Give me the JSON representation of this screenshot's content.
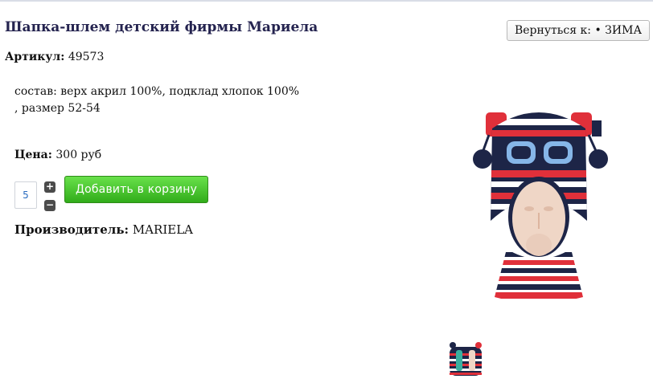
{
  "product": {
    "title": "Шапка-шлем детский фирмы Мариела",
    "sku_label": "Артикул:",
    "sku_value": "49573",
    "description_line1": "состав: верх акрил 100%, подклад хлопок 100%",
    "description_line2": ", размер 52-54",
    "price_label": "Цена:",
    "price_value": "300 руб",
    "manufacturer_label": "Производитель:",
    "manufacturer_value": "MARIELA"
  },
  "back_button": {
    "label": "Вернуться к: • ЗИМА"
  },
  "cart": {
    "quantity": "5",
    "plus": "+",
    "minus": "−",
    "add_label": "Добавить в корзину"
  },
  "colors": {
    "title": "#24234f",
    "add_button": "#31ac1a",
    "hat_navy": "#1d2547",
    "hat_red": "#e0303a",
    "hat_blue": "#86b6e8"
  },
  "icons": [
    "plus-icon",
    "minus-icon"
  ]
}
